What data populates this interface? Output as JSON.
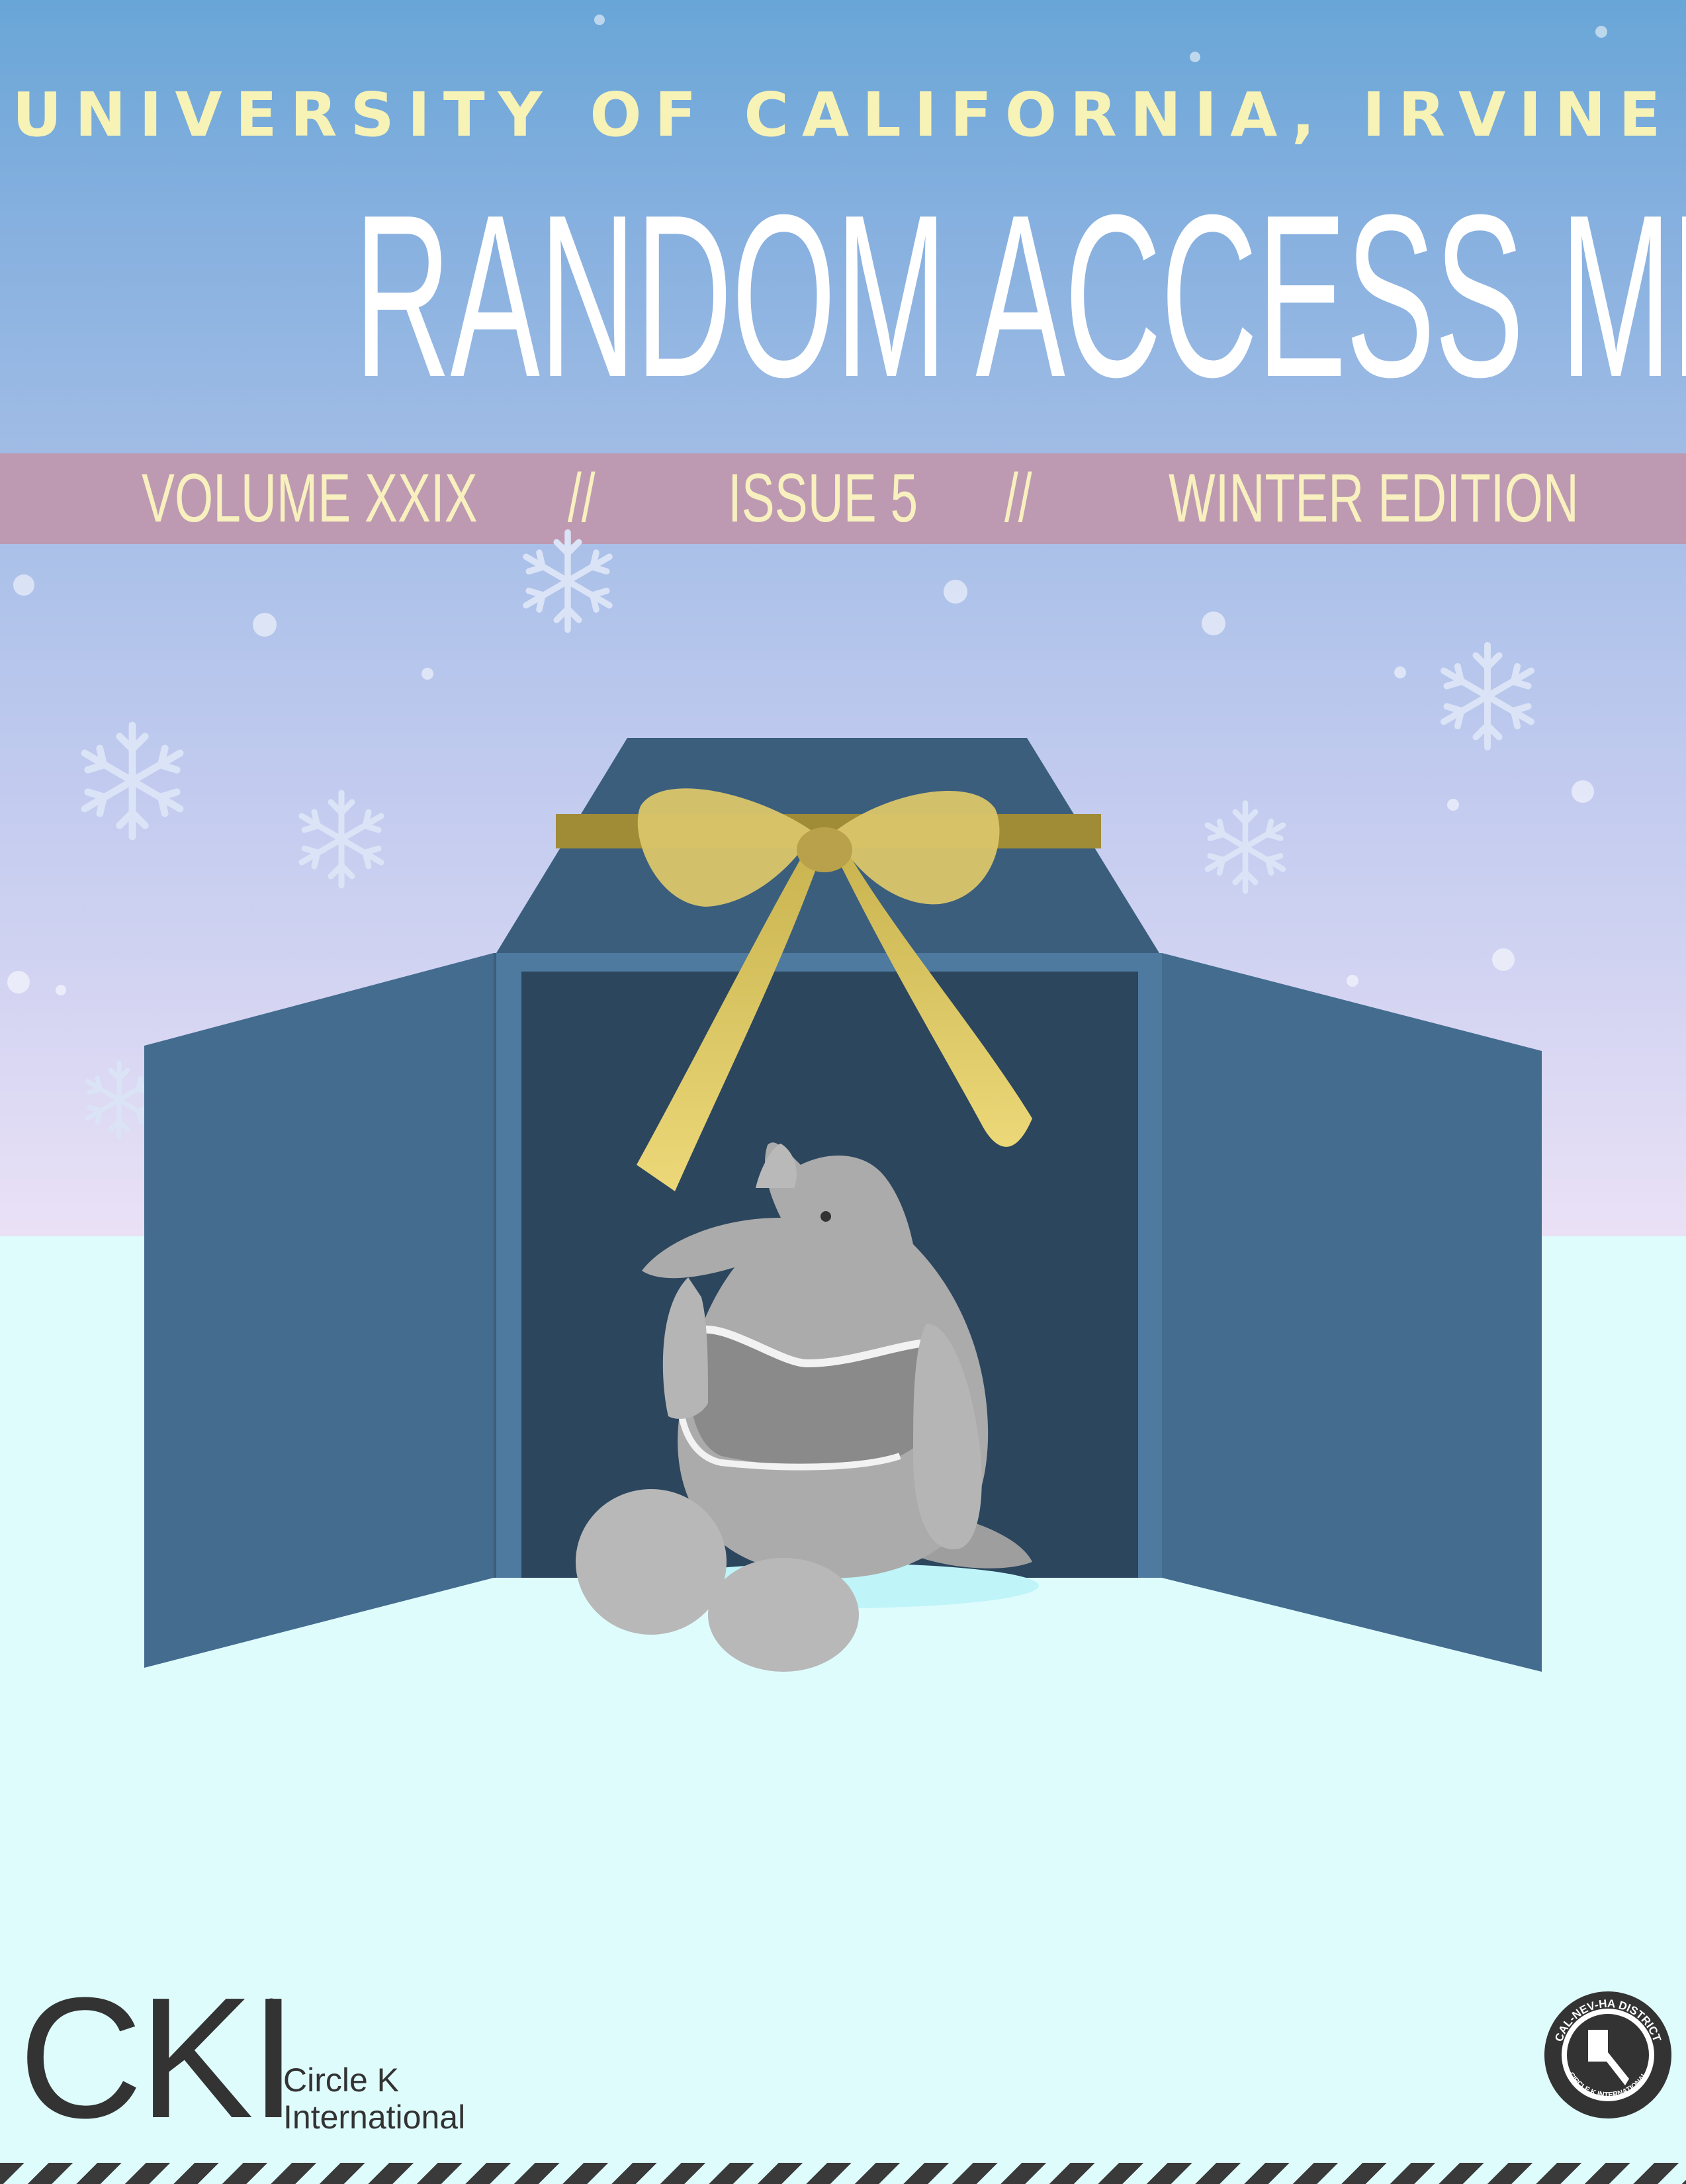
{
  "cover": {
    "university": "UNIVERSITY OF CALIFORNIA, IRVINE",
    "title": "RANDOM ACCESS MEMORY",
    "volume": "VOLUME XXIX",
    "separator": "//",
    "issue": "ISSUE 5",
    "edition": "WINTER EDITION"
  },
  "footer": {
    "logo_text": "CKI",
    "logo_line1": "Circle K",
    "logo_line2": "International",
    "seal_top": "CAL-NEV-HA DISTRICT",
    "seal_bottom": "CIRCLE K INTERNATIONAL"
  },
  "colors": {
    "sky_top": "#68a6d7",
    "sky_bottom": "#eae1f6",
    "ground": "#dffcfd",
    "band": "#bd9ab1",
    "title_yellow": "#f7f2b6",
    "box_blue": "#436c8f",
    "box_interior": "#2c465e",
    "ribbon_gold": "#e2cd6f"
  },
  "illustration": {
    "icons": [
      "snowflake-icon",
      "gift-box",
      "ribbon-bow",
      "anteater-plush"
    ]
  }
}
